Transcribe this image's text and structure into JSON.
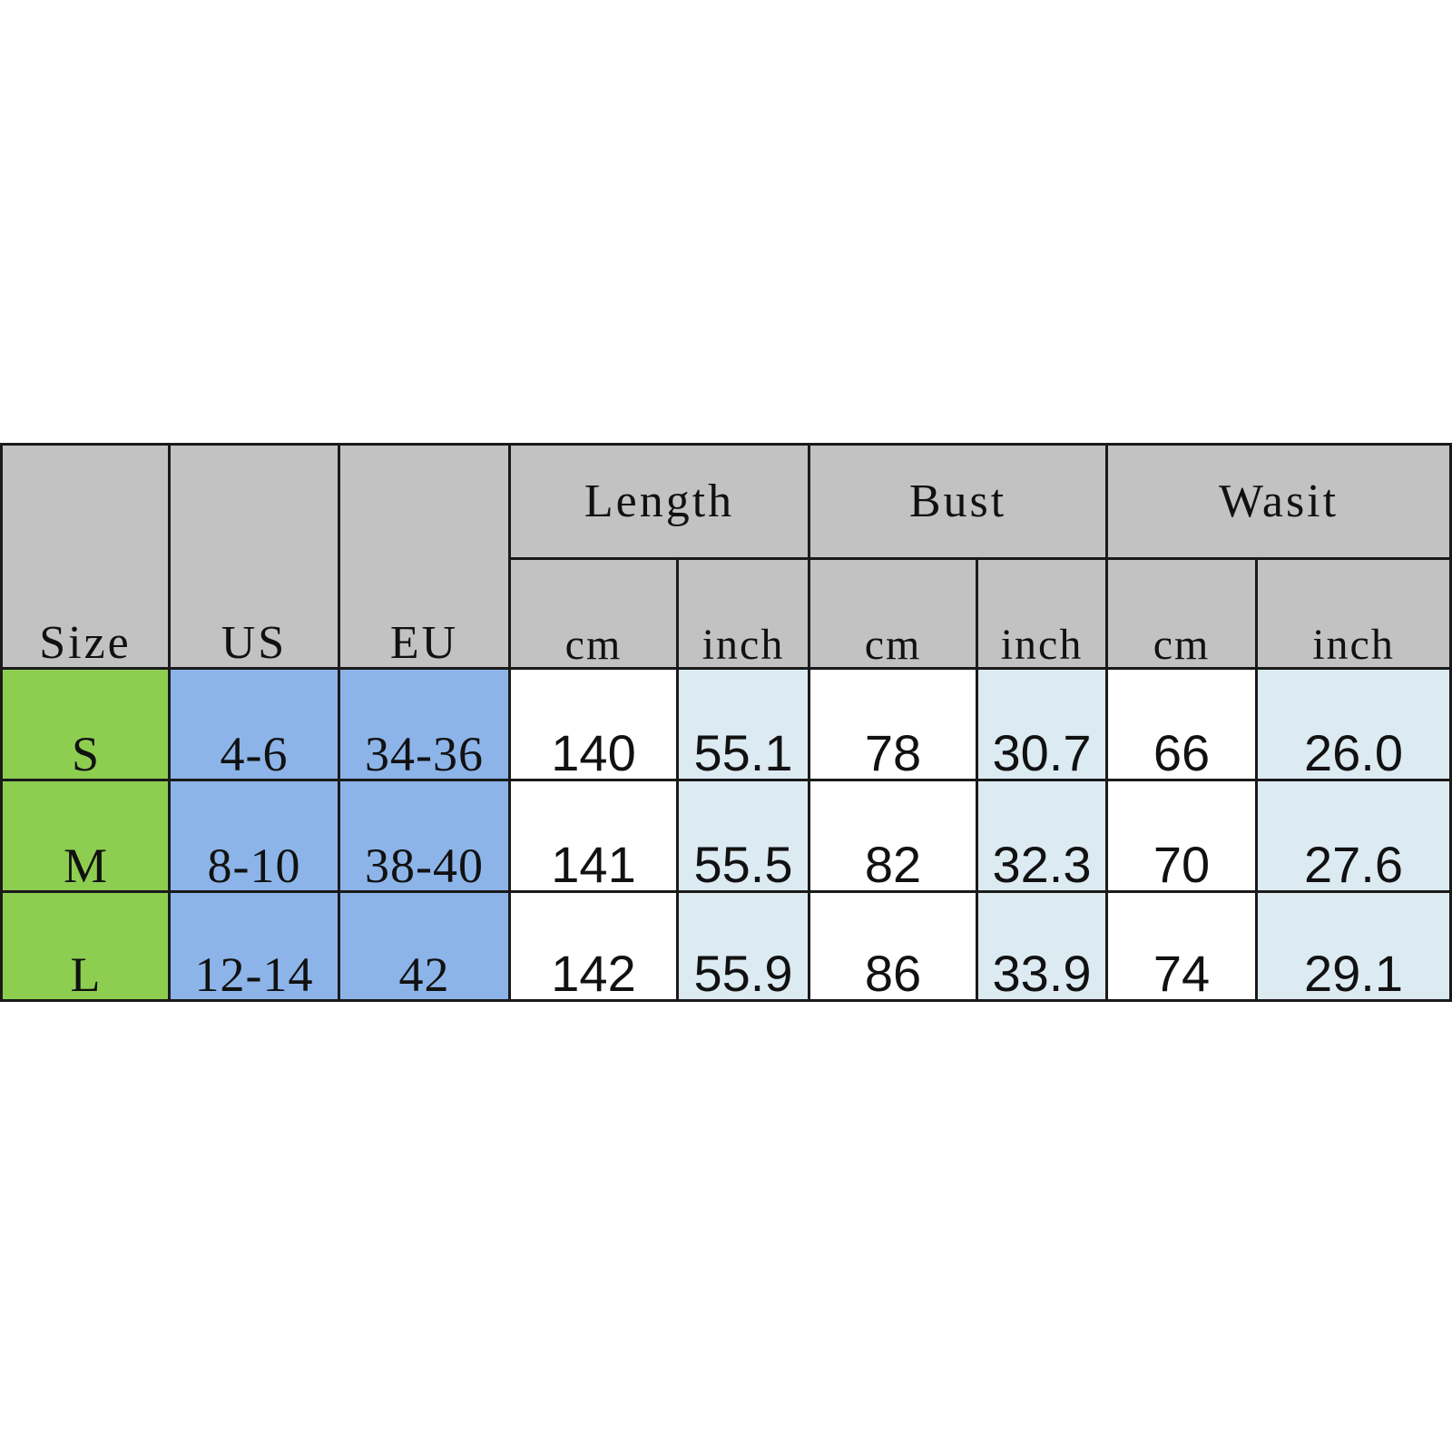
{
  "table": {
    "headers": {
      "size": "Size",
      "us": "US",
      "eu": "EU",
      "groups": [
        {
          "label": "Length",
          "units": [
            "cm",
            "inch"
          ]
        },
        {
          "label": "Bust",
          "units": [
            "cm",
            "inch"
          ]
        },
        {
          "label": "Wasit",
          "units": [
            "cm",
            "inch"
          ]
        }
      ]
    },
    "rows": [
      {
        "size": "S",
        "us": "4-6",
        "eu": "34-36",
        "length_cm": "140",
        "length_inch": "55.1",
        "bust_cm": "78",
        "bust_inch": "30.7",
        "waist_cm": "66",
        "waist_inch": "26.0"
      },
      {
        "size": "M",
        "us": "8-10",
        "eu": "38-40",
        "length_cm": "141",
        "length_inch": "55.5",
        "bust_cm": "82",
        "bust_inch": "32.3",
        "waist_cm": "70",
        "waist_inch": "27.6"
      },
      {
        "size": "L",
        "us": "12-14",
        "eu": "42",
        "length_cm": "142",
        "length_inch": "55.9",
        "bust_cm": "86",
        "bust_inch": "33.9",
        "waist_cm": "74",
        "waist_inch": "29.1"
      }
    ]
  },
  "colors": {
    "header_gray": "#c2c2c2",
    "size_green": "#8dce51",
    "region_blue": "#8cb4e8",
    "inch_cyan": "#dceaf2",
    "cm_white": "#ffffff",
    "border": "#1a1a1a",
    "text": "#111111"
  }
}
